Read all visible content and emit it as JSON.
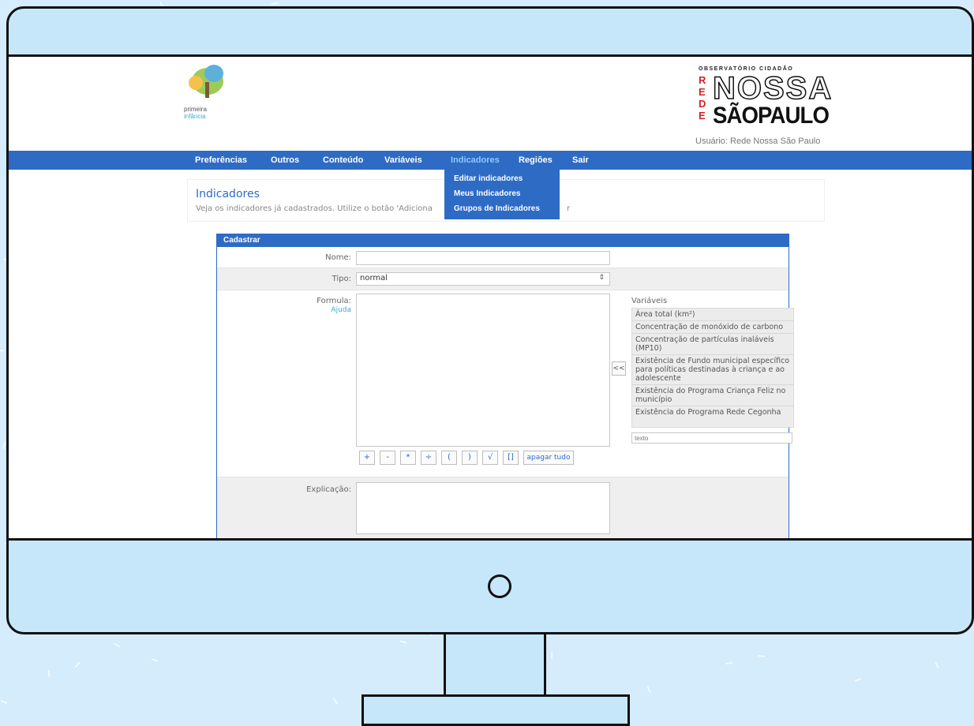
{
  "logo_left": {
    "line1": "primeira",
    "line2": "infância"
  },
  "logo_right": {
    "top": "OBSERVATÓRIO CIDADÃO",
    "rede": [
      "R",
      "E",
      "D",
      "E"
    ],
    "nossa": "NOSSA",
    "sp": "SÃOPAULO"
  },
  "user": "Usuário: Rede Nossa São Paulo",
  "nav": [
    {
      "label": "Preferências"
    },
    {
      "label": "Outros"
    },
    {
      "label": "Conteúdo"
    },
    {
      "label": "Variáveis"
    },
    {
      "label": "Indicadores"
    },
    {
      "label": "Regiões"
    },
    {
      "label": "Sair"
    }
  ],
  "dropdown": [
    "Editar indicadores",
    "Meus Indicadores",
    "Grupos de Indicadores"
  ],
  "page": {
    "title": "Indicadores",
    "desc_left": "Veja os indicadores já cadastrados. Utilize o botão 'Adiciona",
    "desc_right": "r"
  },
  "form": {
    "panel_title": "Cadastrar",
    "nome_label": "Nome:",
    "nome_value": "",
    "tipo_label": "Tipo:",
    "tipo_value": "normal",
    "formula_label": "Formula:",
    "formula_link": "Ajuda",
    "formula_value": "",
    "ops": [
      "+",
      "-",
      "*",
      "÷",
      "(",
      ")",
      "√",
      "[]",
      "apagar tudo"
    ],
    "variaveis_label": "Variáveis",
    "variaveis": [
      "Área total (km²)",
      "Concentração de monóxido de carbono",
      "Concentração de partículas inaláveis (MP10)",
      "Existência de Fundo municipal específico para políticas destinadas à criança e ao adolescente",
      "Existência do Programa Criança Feliz no município",
      "Existência do Programa Rede Cegonha"
    ],
    "insert_label": "<<",
    "search_placeholder": "texto",
    "explicacao_label": "Explicação:",
    "explicacao_value": ""
  }
}
